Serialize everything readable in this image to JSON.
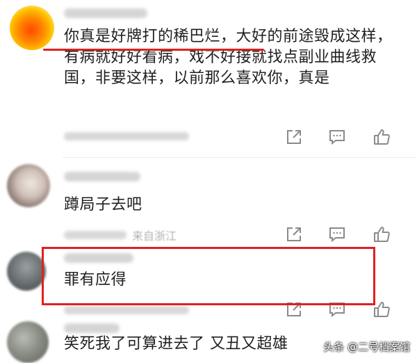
{
  "comments": [
    {
      "text": "你真是好牌打的稀巴烂，大好的前途毁成这样，有病就好好看病，戏不好接就找点副业曲线救国，非要这样，以前那么喜欢你，真是"
    },
    {
      "text": "蹲局子去吧",
      "location": "来自浙江"
    },
    {
      "text": "罪有应得"
    },
    {
      "text": "笑死我了可算进去了 又丑又超雄"
    }
  ],
  "watermark": "头条 @二号档案馆",
  "colors": {
    "highlight": "#e02020",
    "text": "#1f1f1f",
    "icon": "#8a8a8a"
  },
  "icons": [
    "share-icon",
    "comment-icon",
    "like-icon"
  ]
}
